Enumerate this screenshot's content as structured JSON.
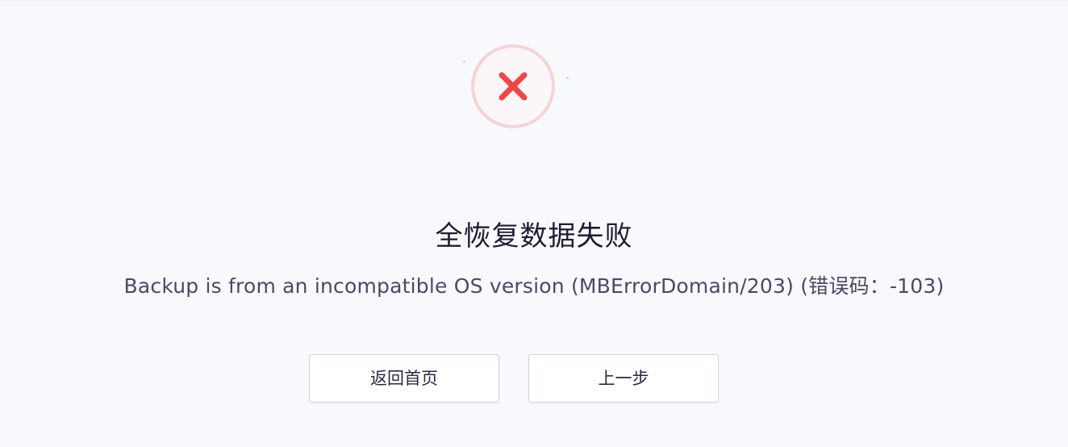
{
  "status": {
    "icon": "error-x-icon",
    "ring_color": "#f6d4d4",
    "x_color": "#ee4747"
  },
  "title": "全恢复数据失败",
  "message": "Backup is from an incompatible OS version (MBErrorDomain/203) (错误码：-103)",
  "buttons": {
    "home_label": "返回首页",
    "previous_label": "上一步"
  }
}
